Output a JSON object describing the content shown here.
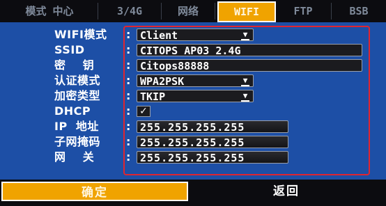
{
  "tabs": [
    {
      "label": "模式 中心"
    },
    {
      "label": "3/4G"
    },
    {
      "label": "网络"
    },
    {
      "label": "WIFI",
      "active": true
    },
    {
      "label": "FTP"
    },
    {
      "label": "BSB"
    }
  ],
  "form": {
    "wifi_mode": {
      "label": "WIFI模式",
      "value": "Client"
    },
    "ssid": {
      "label": "SSID",
      "value": "CITOPS_AP03_2.4G"
    },
    "password": {
      "label": "密    钥",
      "value": "Citops88888"
    },
    "auth_mode": {
      "label": "认证模式",
      "value": "WPA2PSK"
    },
    "encryption": {
      "label": "加密类型",
      "value": "TKIP"
    },
    "dhcp": {
      "label": "DHCP",
      "checked": true,
      "mark": "✓"
    },
    "ip": {
      "label": "IP  地址",
      "value": "255.255.255.255"
    },
    "subnet": {
      "label": "子网掩码",
      "value": "255.255.255.255"
    },
    "gateway": {
      "label": "网    关",
      "value": "255.255.255.255"
    },
    "colon": ":"
  },
  "buttons": {
    "confirm": "确定",
    "back": "返回"
  },
  "colors": {
    "panel_blue": "#1d4fa6",
    "accent_orange": "#f0a300",
    "highlight_red": "#e0252f"
  }
}
